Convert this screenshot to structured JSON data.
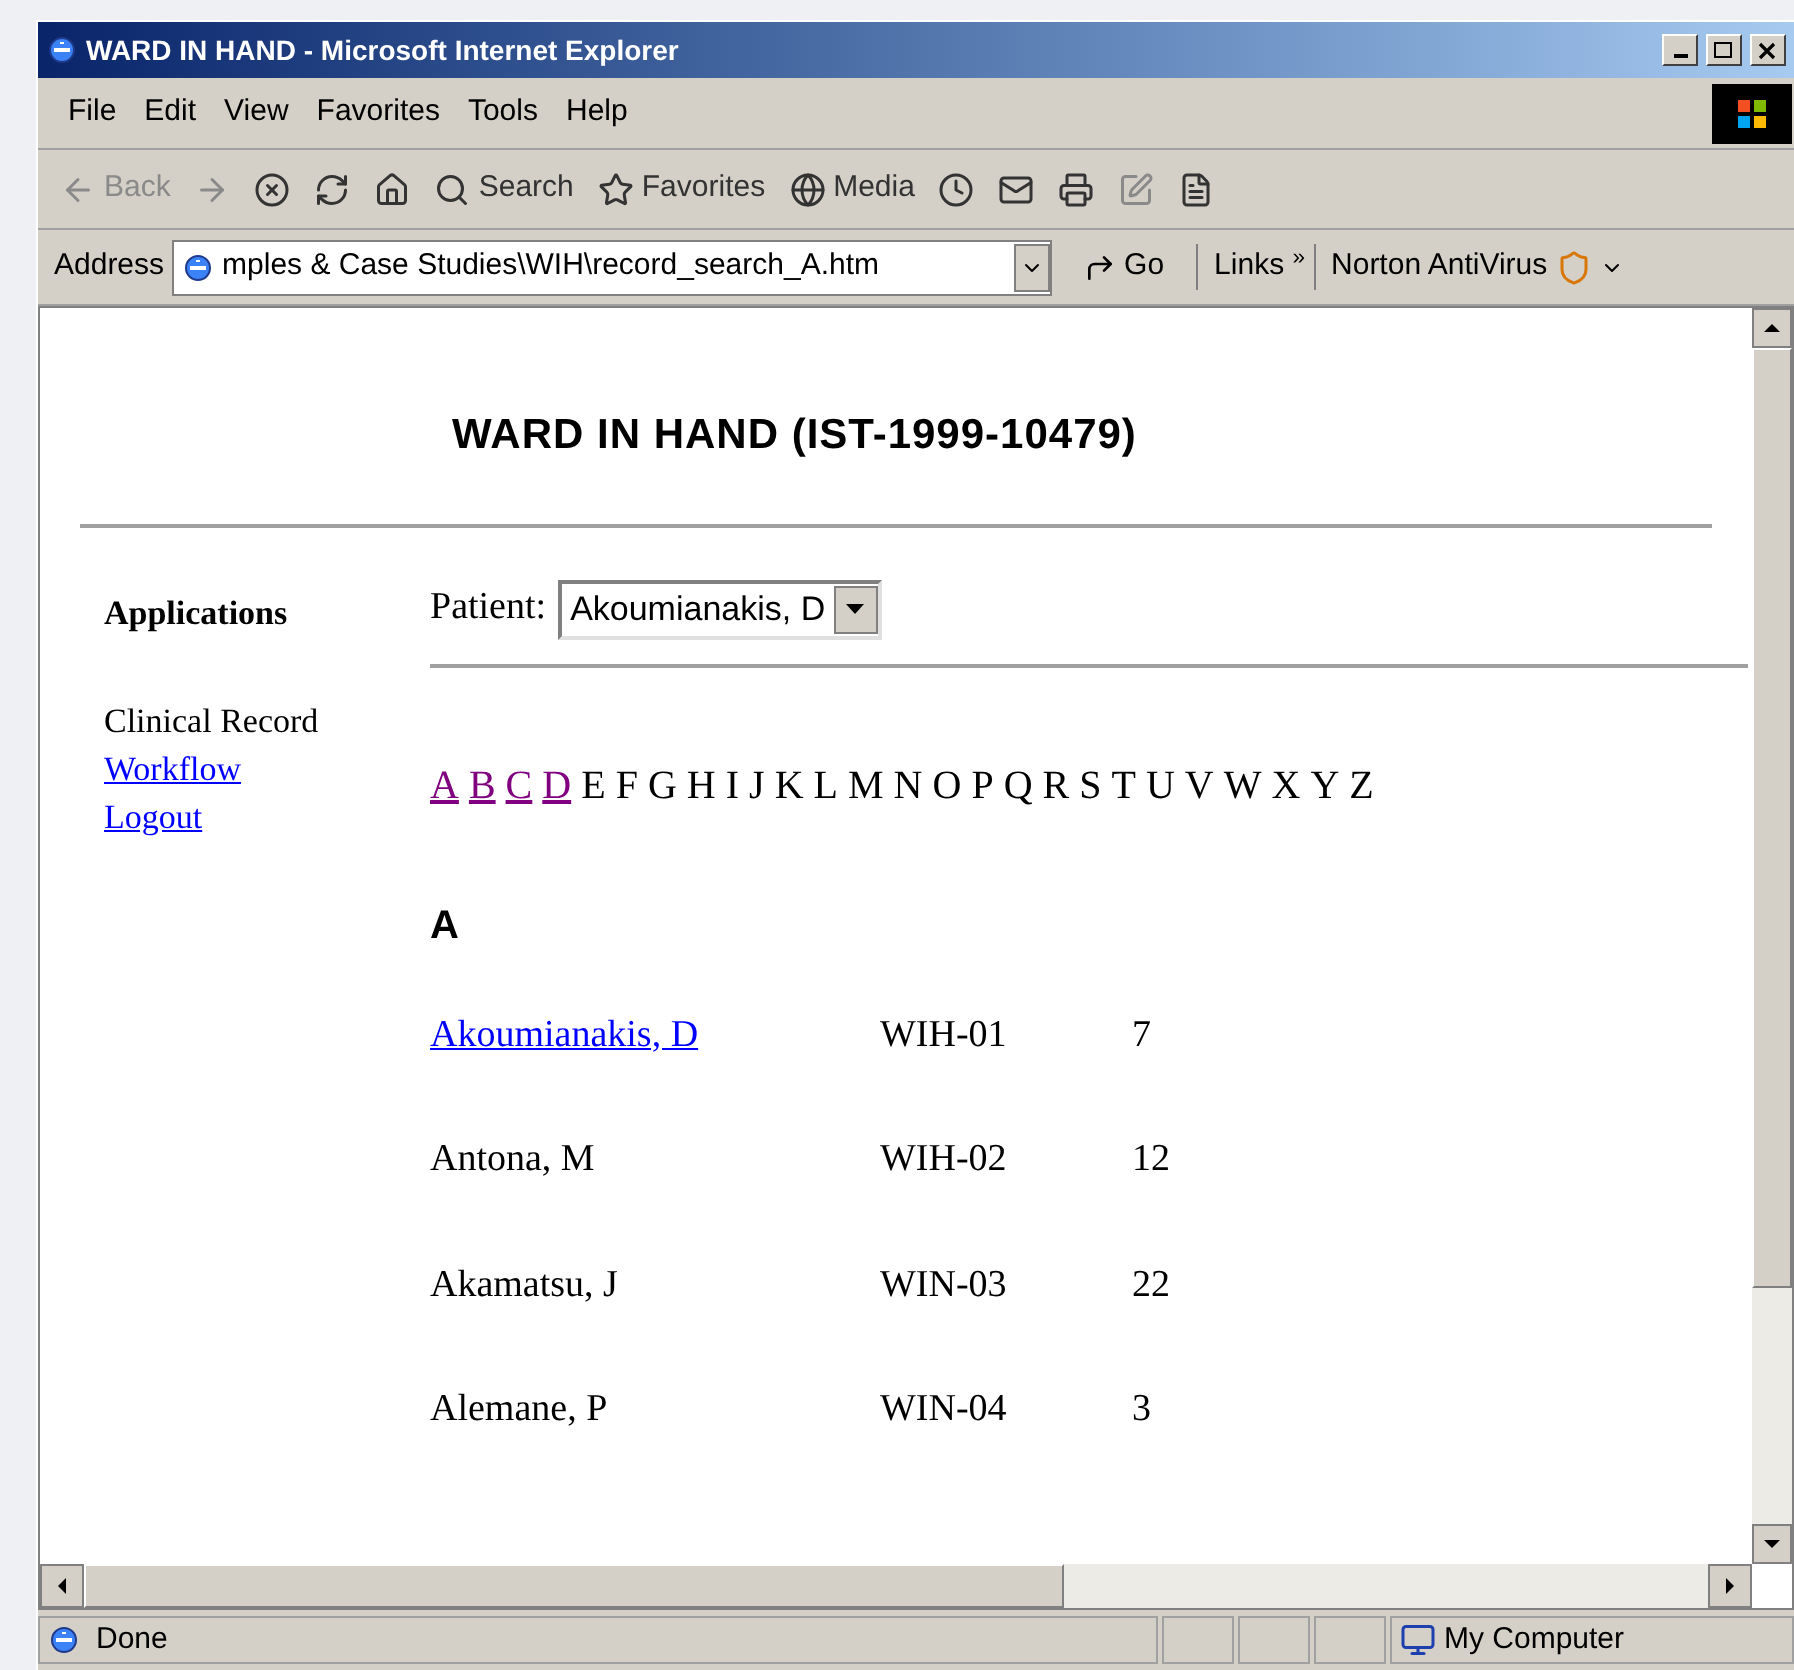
{
  "window": {
    "title": "WARD IN HAND - Microsoft Internet Explorer"
  },
  "menu": [
    "File",
    "Edit",
    "View",
    "Favorites",
    "Tools",
    "Help"
  ],
  "toolbar": [
    {
      "kind": "back",
      "label": "Back",
      "disabled": true
    },
    {
      "kind": "forward",
      "disabled": true
    },
    {
      "kind": "stop",
      "disabled": false
    },
    {
      "kind": "refresh",
      "disabled": false
    },
    {
      "kind": "home",
      "disabled": false
    },
    {
      "kind": "search",
      "label": "Search",
      "disabled": false
    },
    {
      "kind": "favorites",
      "label": "Favorites",
      "disabled": false
    },
    {
      "kind": "media",
      "label": "Media",
      "disabled": false
    },
    {
      "kind": "history",
      "disabled": false
    },
    {
      "kind": "mail",
      "disabled": false
    },
    {
      "kind": "print",
      "disabled": false
    },
    {
      "kind": "edit",
      "disabled": true
    },
    {
      "kind": "discuss",
      "disabled": false
    }
  ],
  "address_bar": {
    "label": "Address",
    "value": "mples & Case Studies\\WIH\\record_search_A.htm",
    "go": "Go",
    "links": "Links",
    "links_chevron": "»",
    "norton": "Norton AntiVirus"
  },
  "page": {
    "heading": "WARD IN HAND (IST-1999-10479)",
    "sidebar": {
      "title": "Applications",
      "items": [
        {
          "label": "Clinical Record",
          "kind": "text"
        },
        {
          "label": "Workflow",
          "kind": "link"
        },
        {
          "label": "Logout",
          "kind": "link"
        }
      ]
    },
    "patient": {
      "label": "Patient:",
      "value": "Akoumianakis, D"
    },
    "letters": [
      {
        "label": "A",
        "kind": "visited"
      },
      {
        "label": "B",
        "kind": "visited"
      },
      {
        "label": "C",
        "kind": "visited"
      },
      {
        "label": "D",
        "kind": "visited"
      },
      {
        "label": "E",
        "kind": "plain"
      },
      {
        "label": "F",
        "kind": "plain"
      },
      {
        "label": "G",
        "kind": "plain"
      },
      {
        "label": "H",
        "kind": "plain"
      },
      {
        "label": "I",
        "kind": "plain"
      },
      {
        "label": "J",
        "kind": "plain"
      },
      {
        "label": "K",
        "kind": "plain"
      },
      {
        "label": "L",
        "kind": "plain"
      },
      {
        "label": "M",
        "kind": "plain"
      },
      {
        "label": "N",
        "kind": "plain"
      },
      {
        "label": "O",
        "kind": "plain"
      },
      {
        "label": "P",
        "kind": "plain"
      },
      {
        "label": "Q",
        "kind": "plain"
      },
      {
        "label": "R",
        "kind": "plain"
      },
      {
        "label": "S",
        "kind": "plain"
      },
      {
        "label": "T",
        "kind": "plain"
      },
      {
        "label": "U",
        "kind": "plain"
      },
      {
        "label": "V",
        "kind": "plain"
      },
      {
        "label": "W",
        "kind": "plain"
      },
      {
        "label": "X",
        "kind": "plain"
      },
      {
        "label": "Y",
        "kind": "plain"
      },
      {
        "label": "Z",
        "kind": "plain"
      }
    ],
    "section": "A",
    "patients": [
      {
        "name": "Akoumianakis, D",
        "link": true,
        "id": "WIH-01",
        "number": "7"
      },
      {
        "name": "Antona, M",
        "link": false,
        "id": "WIH-02",
        "number": "12"
      },
      {
        "name": "Akamatsu, J",
        "link": false,
        "id": "WIN-03",
        "number": "22"
      },
      {
        "name": "Alemane, P",
        "link": false,
        "id": "WIN-04",
        "number": "3"
      }
    ]
  },
  "status_bar": {
    "text": "Done",
    "zone": "My Computer"
  }
}
